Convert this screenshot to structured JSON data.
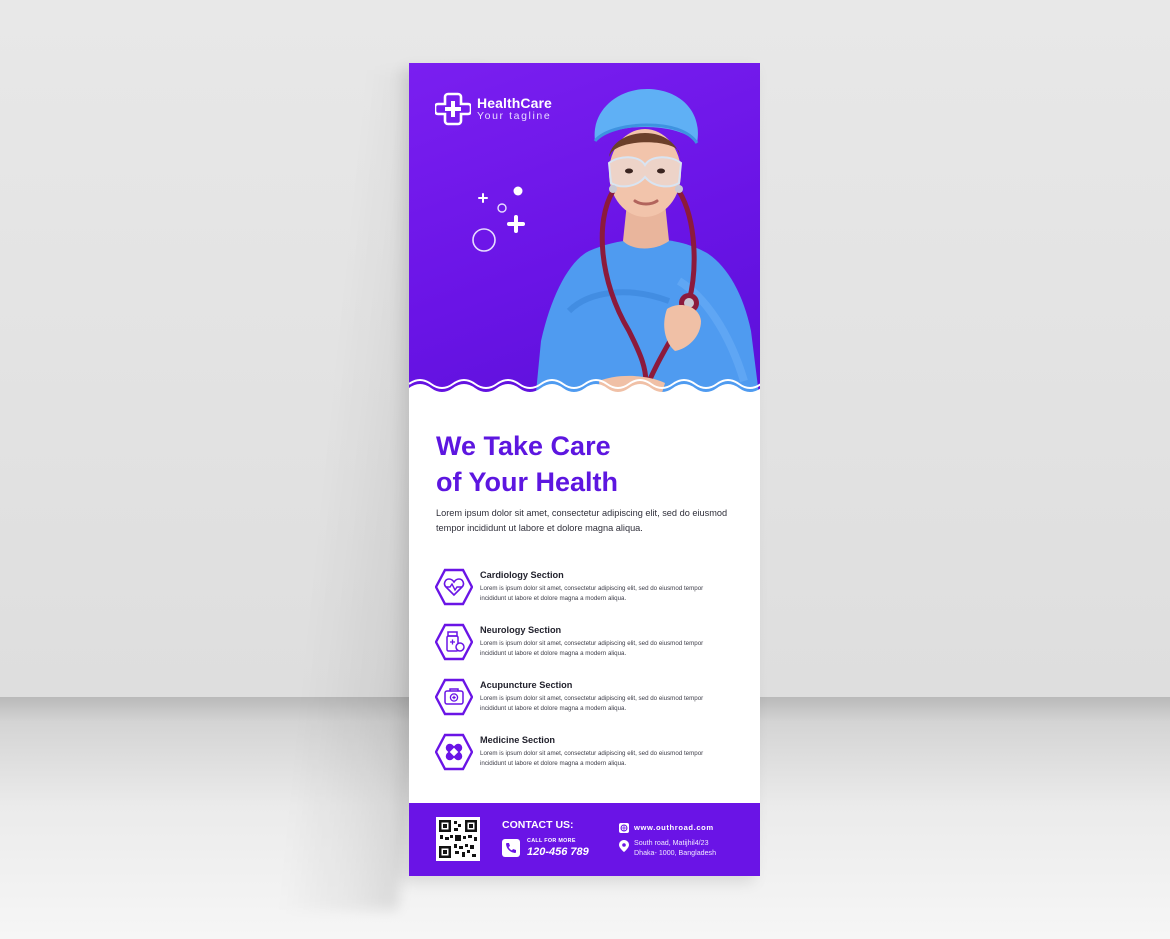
{
  "brand": {
    "name": "HealthCare",
    "tagline": "Your tagline",
    "logo_icon": "cross-plus-icon"
  },
  "colors": {
    "primary": "#6a14e6",
    "headline": "#5d16e0",
    "scrubs": "#4f9bf0"
  },
  "headline": {
    "line1": "We Take Care",
    "line2": "of Your Health"
  },
  "intro": "Lorem ipsum dolor sit amet, consectetur adipiscing elit, sed do eiusmod tempor incididunt ut labore et dolore magna aliqua.",
  "services": [
    {
      "title": "Cardiology Section",
      "icon": "heart-pulse-icon",
      "desc": "Lorem is ipsum dolor sit amet, consectetur adipiscing elit, sed do eiusmod tempor incididunt ut labore et dolore magna a modern aliqua."
    },
    {
      "title": "Neurology Section",
      "icon": "medicine-bottle-icon",
      "desc": "Lorem is ipsum dolor sit amet, consectetur adipiscing elit, sed do eiusmod tempor incididunt ut labore et dolore magna a modern aliqua."
    },
    {
      "title": "Acupuncture Section",
      "icon": "medical-kit-icon",
      "desc": "Lorem is ipsum dolor sit amet, consectetur adipiscing elit, sed do eiusmod tempor incididunt ut labore et dolore magna a modern aliqua."
    },
    {
      "title": "Medicine Section",
      "icon": "bandage-icon",
      "desc": "Lorem is ipsum dolor sit amet, consectetur adipiscing elit, sed do eiusmod tempor incididunt ut labore et dolore magna a modern aliqua."
    }
  ],
  "contact": {
    "heading": "CONTACT US:",
    "call_label": "CALL FOR MORE",
    "phone": "120-456 789",
    "website": "www.outhroad.com",
    "address_line1": "South road, Matijhil4/23",
    "address_line2": "Dhaka- 1000, Bangladesh",
    "qr_icon": "qr-code-icon",
    "phone_icon": "phone-icon",
    "web_icon": "globe-icon",
    "pin_icon": "location-pin-icon"
  }
}
